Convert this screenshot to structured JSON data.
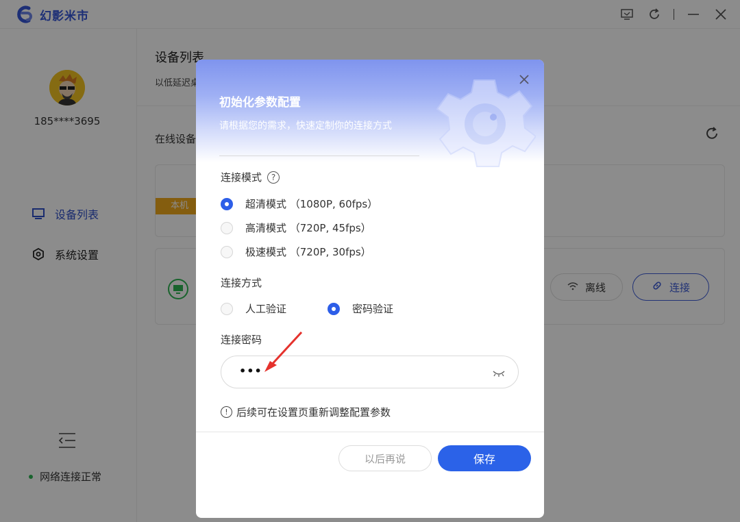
{
  "app": {
    "name": "幻影米市",
    "colors": {
      "brand": "#3657d8",
      "primary_button": "#2b62e8",
      "status_ok": "#2fb552",
      "tag_local": "#f0a91c"
    }
  },
  "window_controls": [
    "screen-cast-icon",
    "refresh-icon",
    "minimize-icon",
    "close-icon"
  ],
  "sidebar": {
    "user_phone": "185****3695",
    "nav": [
      {
        "label": "设备列表",
        "icon": "monitor-icon",
        "active": true
      },
      {
        "label": "系统设置",
        "icon": "hexagon-settings-icon",
        "active": false
      }
    ],
    "network_status": "网络连接正常"
  },
  "main": {
    "title": "设备列表",
    "subtitle": "以低延迟桌",
    "online_devices_label": "在线设备",
    "local_tag": "本机",
    "device_status": "离线",
    "connect_label": "连接"
  },
  "dialog": {
    "title": "初始化参数配置",
    "subtitle": "请根据您的需求，快速定制你的连接方式",
    "mode_label": "连接模式",
    "modes": [
      {
        "label": "超清模式 （1080P, 60fps）",
        "checked": true
      },
      {
        "label": "高清模式 （720P, 45fps）",
        "checked": false
      },
      {
        "label": "极速模式 （720P, 30fps）",
        "checked": false
      }
    ],
    "method_label": "连接方式",
    "methods": [
      {
        "label": "人工验证",
        "checked": false
      },
      {
        "label": "密码验证",
        "checked": true
      }
    ],
    "password_label": "连接密码",
    "password_value": "•••",
    "hint": "后续可在设置页重新调整配置参数",
    "later_button": "以后再说",
    "save_button": "保存"
  }
}
